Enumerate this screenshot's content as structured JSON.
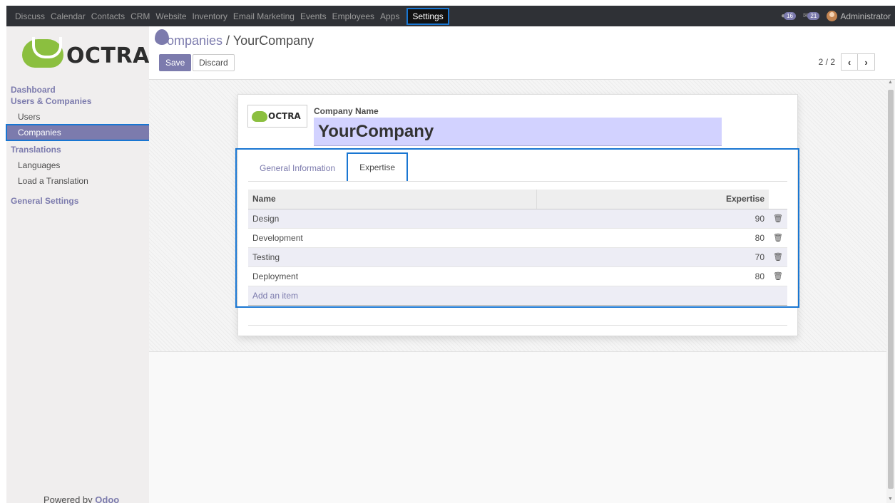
{
  "topbar": {
    "menu": [
      "Discuss",
      "Calendar",
      "Contacts",
      "CRM",
      "Website",
      "Inventory",
      "Email Marketing",
      "Events",
      "Employees",
      "Apps",
      "Settings"
    ],
    "active": "Settings",
    "badges": [
      "16",
      "21"
    ],
    "user": "Administrator"
  },
  "sidebar": {
    "logo_text": "OCTRA",
    "sections": [
      {
        "heading": "Dashboard",
        "items": []
      },
      {
        "heading": "Users & Companies",
        "items": [
          "Users",
          "Companies"
        ]
      },
      {
        "heading": "Translations",
        "items": [
          "Languages",
          "Load a Translation"
        ]
      },
      {
        "heading": "General Settings",
        "items": []
      }
    ],
    "active_item": "Companies",
    "powered_prefix": "Powered by",
    "powered_brand": "Odoo"
  },
  "control": {
    "breadcrumb_link": "ompanies",
    "breadcrumb_sep": " / ",
    "breadcrumb_current": "YourCompany",
    "save_label": "Save",
    "discard_label": "Discard",
    "pager_value": "2 / 2",
    "prev_icon": "‹",
    "next_icon": "›"
  },
  "form": {
    "logo_text": "OCTRA",
    "company_name_label": "Company Name",
    "company_name_value": "YourCompany",
    "tabs": [
      "General Information",
      "Expertise"
    ],
    "active_tab": "Expertise",
    "table": {
      "headers": [
        "Name",
        "Expertise"
      ],
      "rows": [
        {
          "name": "Design",
          "expertise": "90"
        },
        {
          "name": "Development",
          "expertise": "80"
        },
        {
          "name": "Testing",
          "expertise": "70"
        },
        {
          "name": "Deployment",
          "expertise": "80"
        }
      ],
      "add_label": "Add an item"
    }
  },
  "colors": {
    "accent": "#7c7bad",
    "highlight_box": "#1976d2",
    "navbar": "#2f3136",
    "logo_green": "#8bbf3f"
  }
}
